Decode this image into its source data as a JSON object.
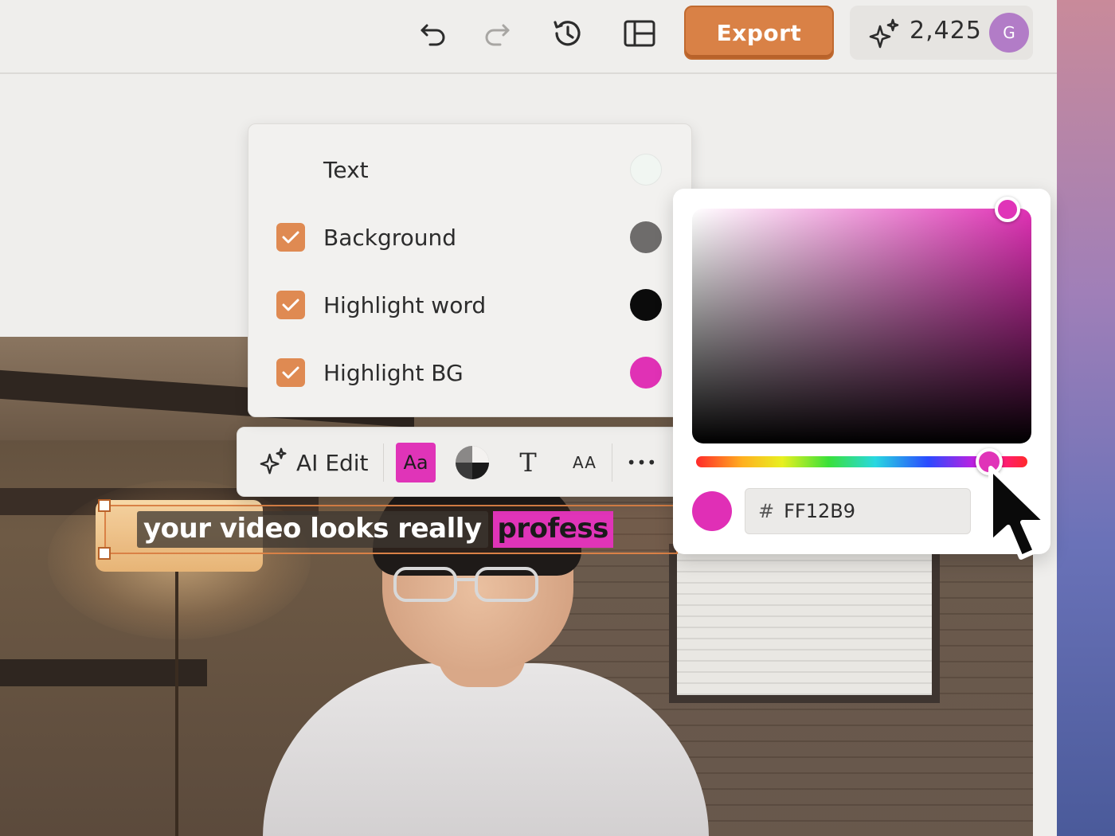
{
  "toolbar": {
    "undo_icon": "undo-icon",
    "redo_icon": "redo-icon",
    "history_icon": "history-icon",
    "layout_icon": "layout-icon",
    "export_label": "Export",
    "credits_count": "2,425",
    "avatar_initial": "G"
  },
  "color_options": {
    "items": [
      {
        "label": "Text",
        "checked": false,
        "color": "#f1f6f2"
      },
      {
        "label": "Background",
        "checked": true,
        "color": "#6e6c6b"
      },
      {
        "label": "Highlight word",
        "checked": true,
        "color": "#0b0b0b"
      },
      {
        "label": "Highlight BG",
        "checked": true,
        "color": "#e031b5"
      }
    ]
  },
  "caption_toolbar": {
    "ai_edit_label": "AI Edit",
    "aa_label": "Aa",
    "t_label": "T",
    "aa_small_label": "AA",
    "more_label": "•••"
  },
  "caption": {
    "normal_text": "your video looks really",
    "highlight_text": "profess"
  },
  "color_picker": {
    "hash": "#",
    "hex_value": "FF12B9",
    "accent": "#e034b8"
  },
  "colors": {
    "brand_orange": "#d98146",
    "highlight_magenta": "#e034b8"
  }
}
